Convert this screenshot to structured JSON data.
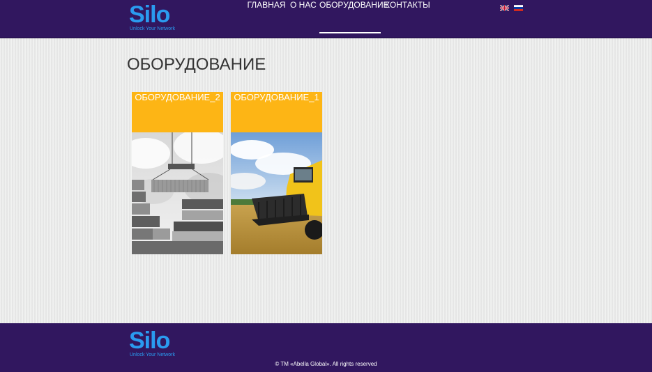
{
  "header": {
    "logo": {
      "wordmark": "Silo",
      "tagline": "Unlock Your Network"
    },
    "nav": [
      {
        "label": "ГЛАВНАЯ",
        "active": false
      },
      {
        "label": "О НАС",
        "active": false
      },
      {
        "label": "ОБОРУДОВАНИЕ",
        "active": true
      },
      {
        "label": "КОНТАКТЫ",
        "active": false
      }
    ],
    "languages": [
      {
        "icon": "uk-flag-icon"
      },
      {
        "icon": "russia-flag-icon"
      }
    ]
  },
  "main": {
    "title": "ОБОРУДОВАНИЕ",
    "cards": [
      {
        "label": "ОБОРУДОВАНИЕ_2",
        "image": "shipping-containers-crane"
      },
      {
        "label": "ОБОРУДОВАНИЕ_1",
        "image": "combine-harvester-field"
      }
    ]
  },
  "footer": {
    "logo": {
      "wordmark": "Silo",
      "tagline": "Unlock Your Network"
    },
    "copyright": "© TM «Abella Global». All rights reserved"
  },
  "colors": {
    "header_bg": "#31175f",
    "brand_blue": "#2a9bf0",
    "card_header": "#fdb515",
    "page_bg": "#ecedec"
  }
}
